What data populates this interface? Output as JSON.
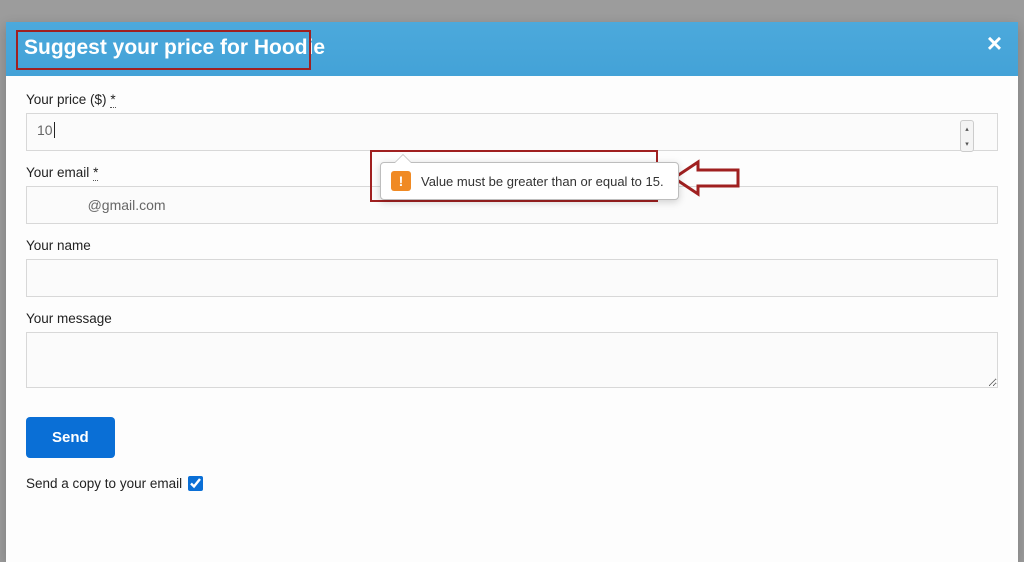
{
  "modal": {
    "title": "Suggest your price for Hoodie",
    "close_glyph": "×"
  },
  "form": {
    "price": {
      "label": "Your price ($)",
      "required_mark": "*",
      "value": "10"
    },
    "email": {
      "label": "Your email",
      "required_mark": "*",
      "value": "             @gmail.com"
    },
    "name": {
      "label": "Your name",
      "value": ""
    },
    "message": {
      "label": "Your message",
      "value": ""
    },
    "send_label": "Send",
    "copy_label": "Send a copy to your email",
    "copy_checked": true
  },
  "validation": {
    "message": "Value must be greater than or equal to 15.",
    "icon_glyph": "!"
  }
}
